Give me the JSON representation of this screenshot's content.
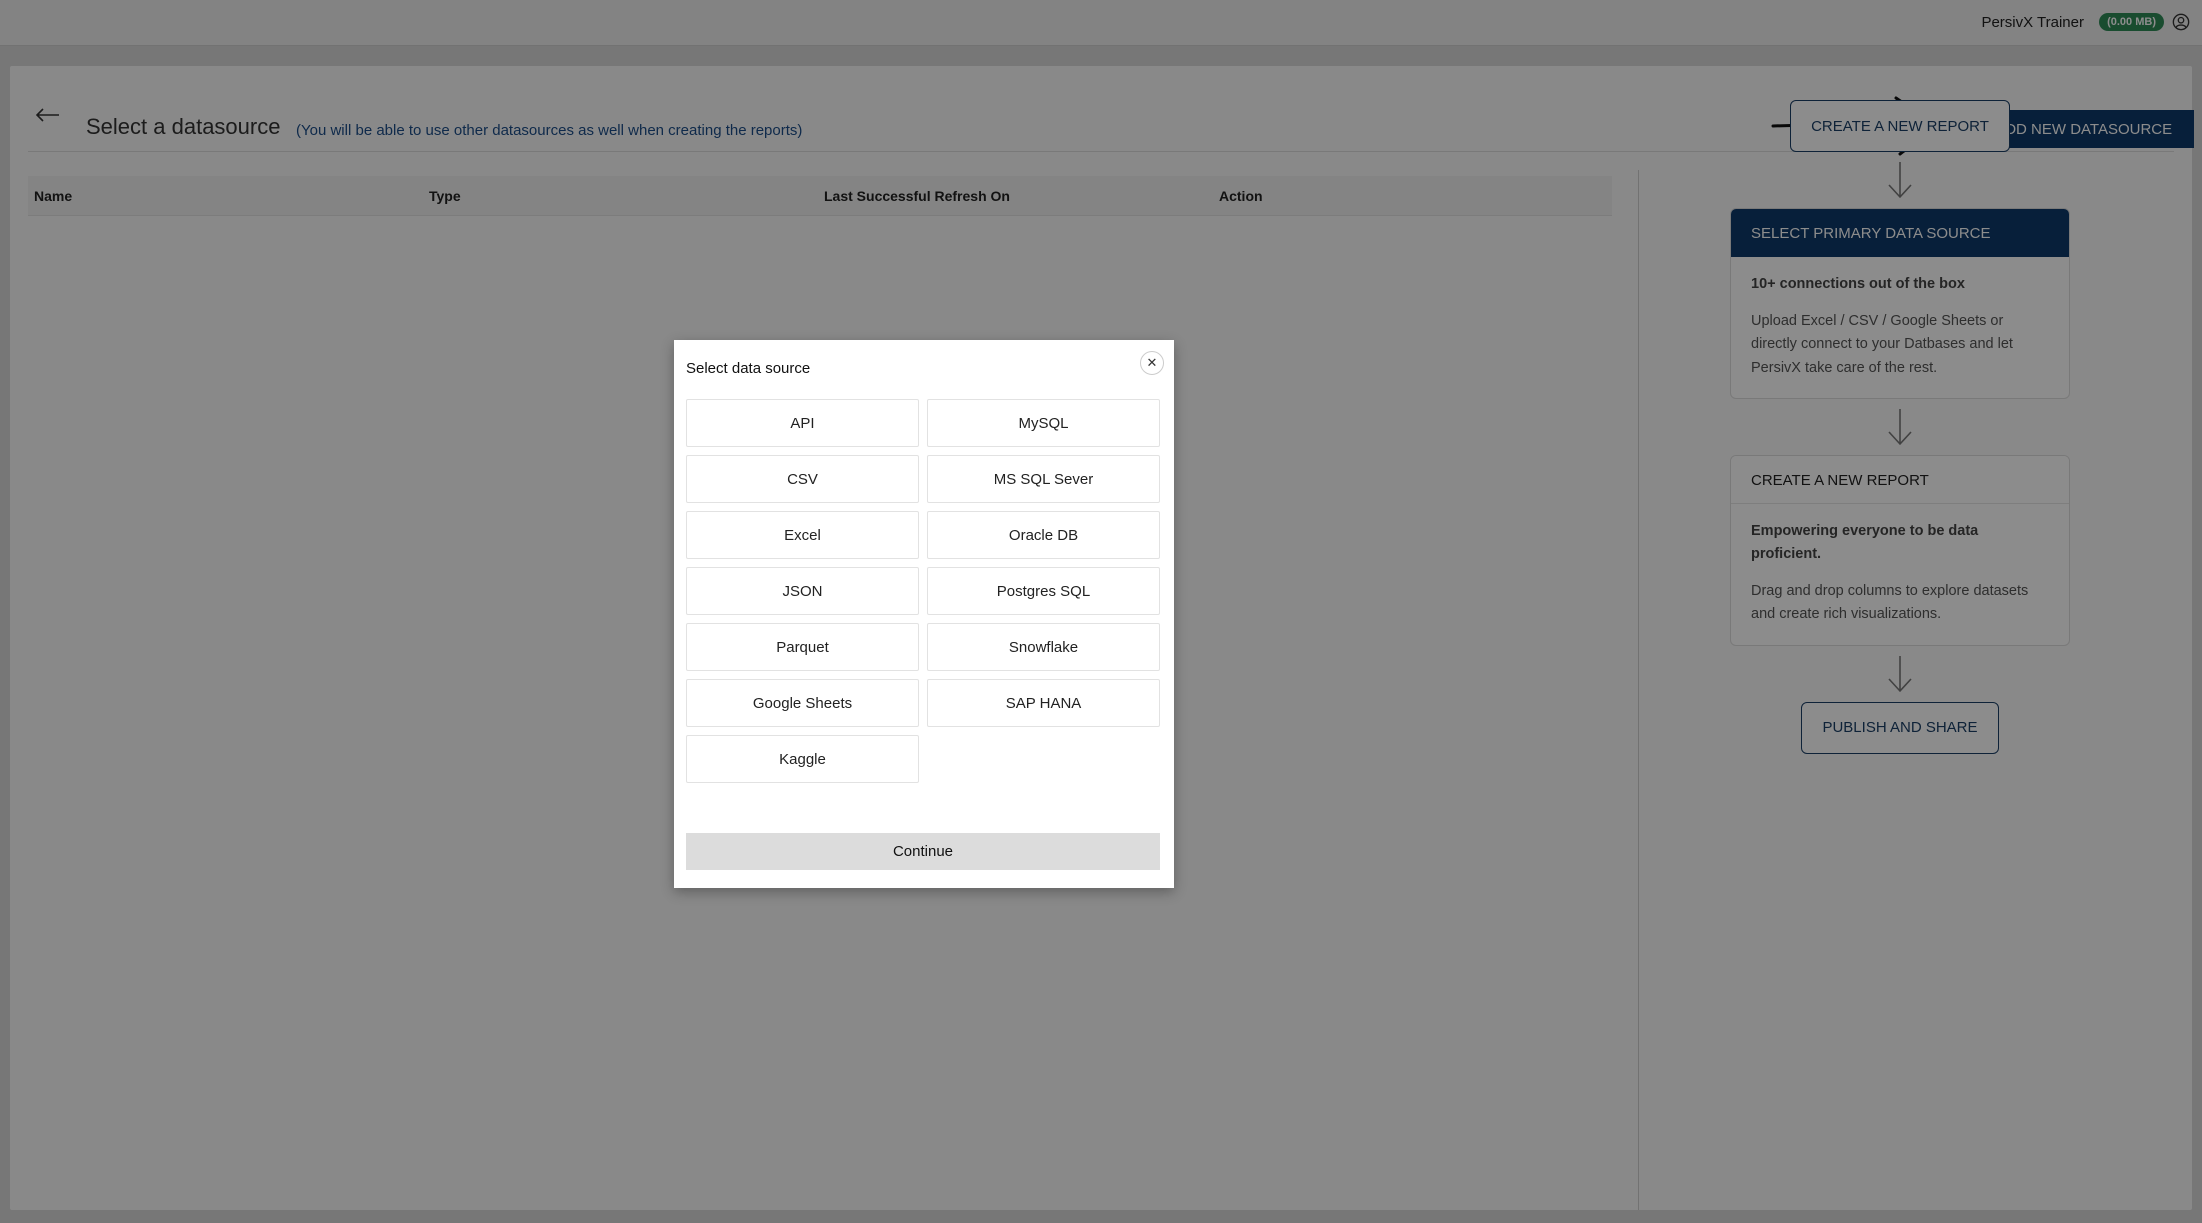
{
  "topbar": {
    "user_name": "PersivX Trainer",
    "storage_badge": "(0.00 MB)"
  },
  "header": {
    "title": "Select a datasource",
    "note": "(You will be able to use other datasources as well when creating the reports)",
    "add_button_label": "ADD NEW DATASOURCE",
    "add_button_icon": "+"
  },
  "table": {
    "columns": [
      "Name",
      "Type",
      "Last Successful Refresh On",
      "Action"
    ],
    "rows": []
  },
  "flow": {
    "create_report_button": "CREATE A NEW REPORT",
    "steps": [
      {
        "title": "SELECT PRIMARY DATA SOURCE",
        "lead": "10+ connections out of the box",
        "body": "Upload Excel / CSV / Google Sheets or directly connect to your Datbases and let PersivX take care of the rest.",
        "active": true
      },
      {
        "title": "CREATE A NEW REPORT",
        "lead": "Empowering everyone to be data proficient.",
        "body": "Drag and drop columns to explore datasets and create rich visualizations.",
        "active": false
      }
    ],
    "publish_button": "PUBLISH AND SHARE"
  },
  "modal": {
    "title": "Select data source",
    "options": [
      "API",
      "MySQL",
      "CSV",
      "MS SQL Sever",
      "Excel",
      "Oracle DB",
      "JSON",
      "Postgres SQL",
      "Parquet",
      "Snowflake",
      "Google Sheets",
      "SAP HANA",
      "Kaggle"
    ],
    "continue_label": "Continue"
  },
  "colors": {
    "primary": "#0e3a6a",
    "badge": "#2e8b57",
    "note_text": "#1d4e89"
  }
}
